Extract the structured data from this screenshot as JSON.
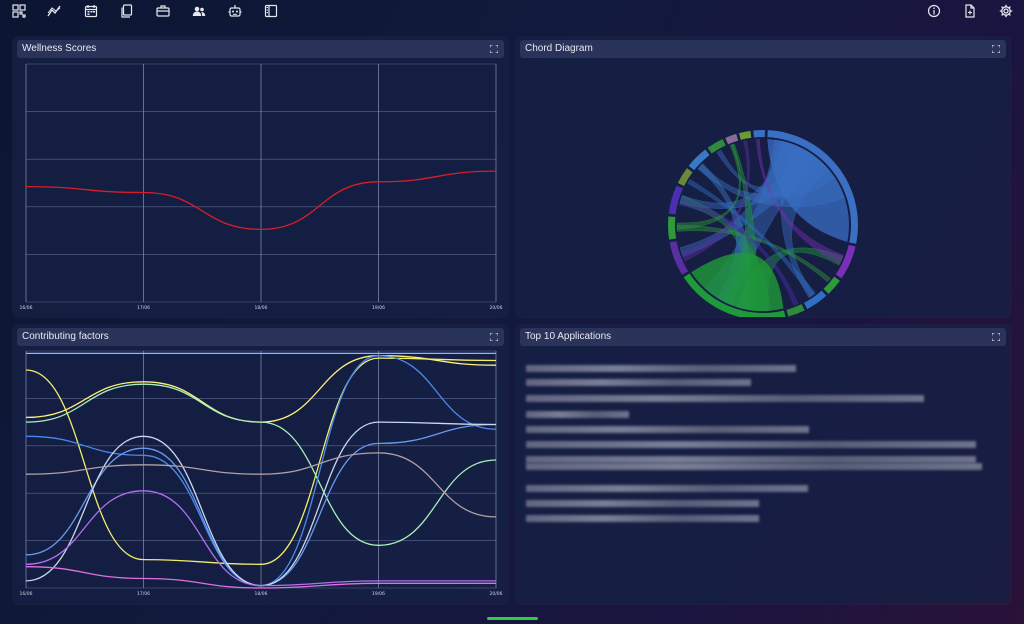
{
  "toolbar": {
    "left_icons": [
      "dashboard-icon",
      "trend-icon",
      "calendar-icon",
      "documents-icon",
      "briefcase-icon",
      "users-icon",
      "robot-icon",
      "panel-icon"
    ],
    "right_icons": [
      "info-icon",
      "file-icon",
      "settings-icon"
    ]
  },
  "panels": {
    "wellness": {
      "title": "Wellness Scores"
    },
    "chord": {
      "title": "Chord Diagram"
    },
    "factors": {
      "title": "Contributing factors"
    },
    "apps": {
      "title": "Top 10 Applications"
    }
  },
  "colors": {
    "accent_green": "#2ecc40",
    "wellness_line": "#d81e2a",
    "grid": "#7d86a8"
  },
  "chart_data": [
    {
      "type": "line",
      "x": [
        "16/06",
        "17/06",
        "18/06",
        "19/06",
        "20/06"
      ],
      "series": [
        {
          "values": [
            4.85,
            4.6,
            3.05,
            5.05,
            5.5
          ],
          "color": "#d81e2a"
        }
      ],
      "ylim": [
        0,
        10
      ],
      "grid": true
    },
    {
      "type": "chord",
      "groups": [
        {
          "color": "#3a6fc4",
          "share": 0.28
        },
        {
          "color": "#7a2fb8",
          "share": 0.06
        },
        {
          "color": "#2f9a3a",
          "share": 0.03
        },
        {
          "color": "#2f6fc4",
          "share": 0.04
        },
        {
          "color": "#2f8a3a",
          "share": 0.03
        },
        {
          "color": "#1f9a3a",
          "share": 0.2
        },
        {
          "color": "#5a2fa0",
          "share": 0.06
        },
        {
          "color": "#2f9a3a",
          "share": 0.04
        },
        {
          "color": "#4a2fb0",
          "share": 0.05
        },
        {
          "color": "#6a8a3a",
          "share": 0.03
        },
        {
          "color": "#3a7ac4",
          "share": 0.04
        },
        {
          "color": "#2f8a3a",
          "share": 0.03
        },
        {
          "color": "#8a6a9a",
          "share": 0.02
        },
        {
          "color": "#6a9a3a",
          "share": 0.02
        },
        {
          "color": "#3a6fc4",
          "share": 0.02
        }
      ]
    },
    {
      "type": "line",
      "x": [
        "16/06",
        "17/06",
        "18/06",
        "19/06",
        "20/06"
      ],
      "series": [
        {
          "values": [
            7.2,
            8.7,
            7.0,
            9.8,
            9.4
          ],
          "color": "#fff07a"
        },
        {
          "values": [
            9.2,
            1.2,
            1.0,
            9.7,
            9.6
          ],
          "color": "#f2ee6a"
        },
        {
          "values": [
            7.0,
            8.6,
            7.0,
            1.8,
            5.4
          ],
          "color": "#a8f0b8"
        },
        {
          "values": [
            6.4,
            5.6,
            0.1,
            9.8,
            6.7
          ],
          "color": "#4a8af0"
        },
        {
          "values": [
            1.4,
            5.9,
            0.1,
            6.1,
            6.9
          ],
          "color": "#6a9af0"
        },
        {
          "values": [
            0.3,
            6.4,
            0.1,
            7.0,
            6.9
          ],
          "color": "#c8d8f0"
        },
        {
          "values": [
            4.8,
            5.2,
            4.8,
            5.7,
            3.0
          ],
          "color": "#b0a0a8"
        },
        {
          "values": [
            1.0,
            4.1,
            0.1,
            0.3,
            0.3
          ],
          "color": "#b070f0"
        },
        {
          "values": [
            0.9,
            0.4,
            0.0,
            0.2,
            0.2
          ],
          "color": "#e070e0"
        },
        {
          "values": [
            9.9,
            9.9,
            9.9,
            9.9,
            9.9
          ],
          "color": "#8ab8ff"
        }
      ],
      "ylim": [
        0,
        10
      ],
      "grid": true
    }
  ]
}
